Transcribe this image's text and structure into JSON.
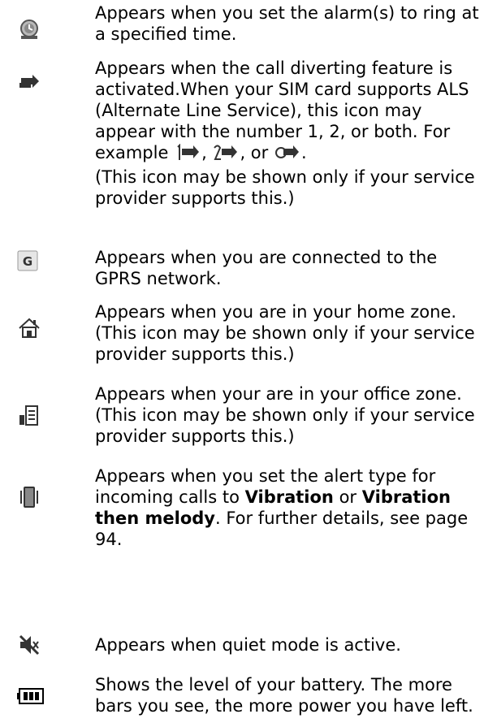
{
  "entries": [
    {
      "icon": "alarm-icon",
      "text": "Appears when you set the alarm(s) to ring at a specified time."
    },
    {
      "icon": "call-divert-icon",
      "text": "Appears when the call diverting feature is activated.When your SIM card supports ALS (Alternate Line Service), this icon may appear with the number 1, 2, or both. For example",
      "sep1": ",",
      "sep2": ", or",
      "end": ".",
      "note": "(This icon may be shown only if your service provider supports this.)",
      "inline_icons": [
        "call-divert-line1-icon",
        "call-divert-line2-icon",
        "call-divert-both-icon"
      ]
    },
    {
      "icon": "gprs-icon",
      "glyph": "G",
      "text": "Appears when you are connected to the GPRS network."
    },
    {
      "icon": "home-zone-icon",
      "text": "Appears when you are in your home zone. (This icon may be shown only if your service provider supports this.)"
    },
    {
      "icon": "office-zone-icon",
      "text": "Appears when your are in your office zone. (This icon may be shown only if your service provider supports this.)"
    },
    {
      "icon": "vibration-icon",
      "t1": "Appears when you set the alert type for incoming calls to",
      "b1": "Vibration",
      "t2": "or",
      "b2": "Vibration then melody",
      "t3": ". For further details, see page 94."
    },
    {
      "icon": "quiet-mode-icon",
      "text": "Appears when quiet mode is active."
    },
    {
      "icon": "battery-icon",
      "text": "Shows the level of your battery. The more bars you see, the more power you have left."
    }
  ]
}
